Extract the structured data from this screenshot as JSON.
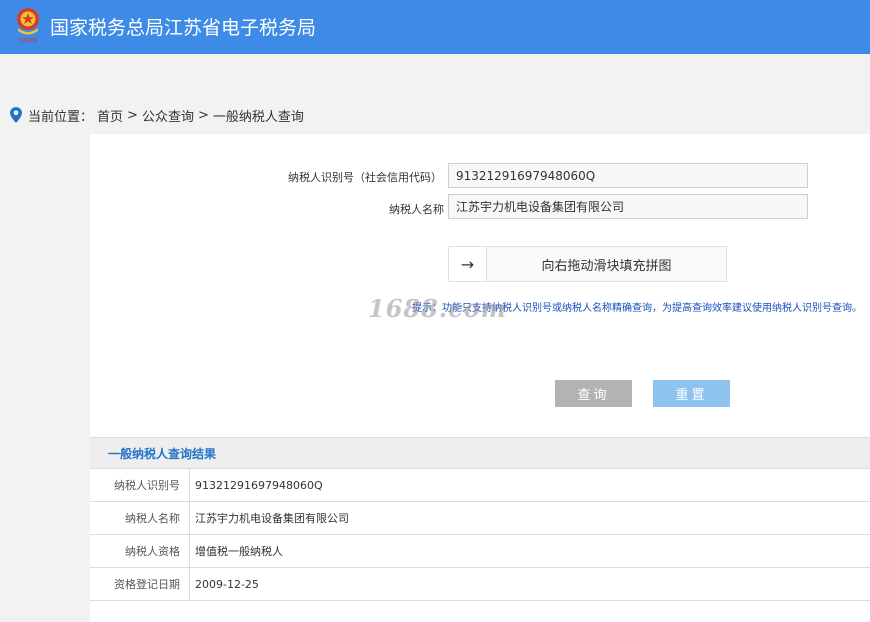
{
  "header": {
    "logo_text": "江苏税务",
    "title": "国家税务总局江苏省电子税务局",
    "brand_color": "#3d8be6"
  },
  "breadcrumb": {
    "location_label": "当前位置：",
    "home": "首页",
    "sep1": ">",
    "level2": "公众查询",
    "sep2": ">",
    "current": "一般纳税人查询"
  },
  "form": {
    "taxpayer_id_label": "纳税人识别号（社会信用代码）",
    "taxpayer_id_value": "91321291697948060Q",
    "taxpayer_name_label": "纳税人名称",
    "taxpayer_name_value": "江苏宇力机电设备集团有限公司",
    "slider_arrow": "→",
    "slider_text": "向右拖动滑块填充拼图",
    "tip": "提示：功能只支持纳税人识别号或纳税人名称精确查询，为提高查询效率建议使用纳税人识别号查询。",
    "watermark": "1688.com",
    "query_button": "查询",
    "reset_button": "重置"
  },
  "result": {
    "title": "一般纳税人查询结果",
    "rows": [
      {
        "label": "纳税人识别号",
        "value": "91321291697948060Q"
      },
      {
        "label": "纳税人名称",
        "value": "江苏宇力机电设备集团有限公司"
      },
      {
        "label": "纳税人资格",
        "value": "增值税一般纳税人"
      },
      {
        "label": "资格登记日期",
        "value": "2009-12-25"
      }
    ]
  }
}
